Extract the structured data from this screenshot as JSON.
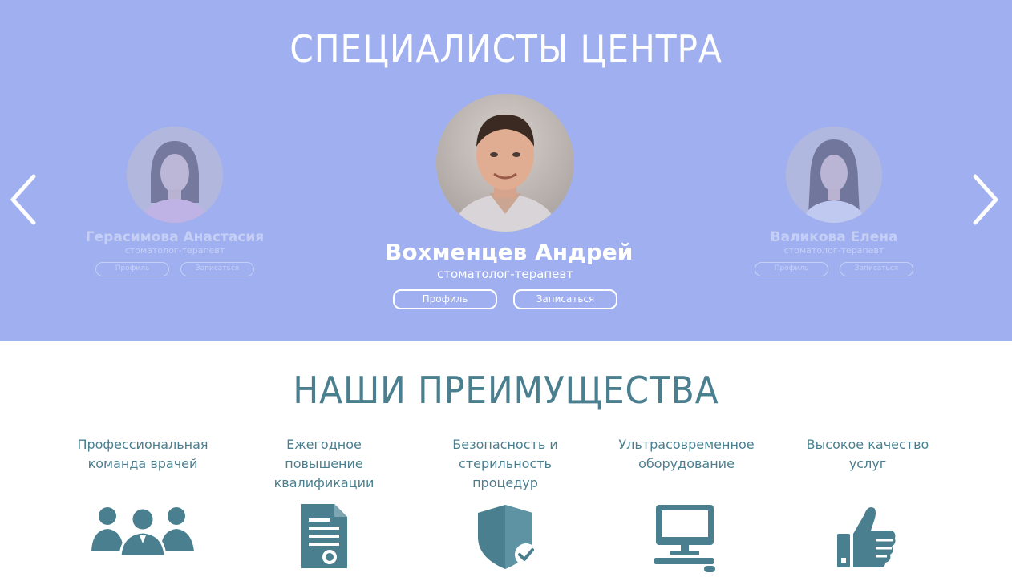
{
  "specialists": {
    "title": "СПЕЦИАЛИСТЫ ЦЕНТРА",
    "doctors": [
      {
        "name": "Герасимова Анастасия",
        "role": "стоматолог-терапевт",
        "profile_label": "Профиль",
        "book_label": "Записаться"
      },
      {
        "name": "Вохменцев Андрей",
        "role": "стоматолог-терапевт",
        "profile_label": "Профиль",
        "book_label": "Записаться"
      },
      {
        "name": "Валикова Елена",
        "role": "стоматолог-терапевт",
        "profile_label": "Профиль",
        "book_label": "Записаться"
      }
    ],
    "prev_icon": "chevron-left-icon",
    "next_icon": "chevron-right-icon"
  },
  "advantages": {
    "title": "НАШИ ПРЕИМУЩЕСТВА",
    "items": [
      {
        "label": "Профессиональная команда врачей",
        "icon": "team-icon"
      },
      {
        "label": "Ежегодное повышение квалификации",
        "icon": "certificate-icon"
      },
      {
        "label": "Безопасность и стерильность процедур",
        "icon": "shield-check-icon"
      },
      {
        "label": "Ультрасовременное оборудование",
        "icon": "computer-icon"
      },
      {
        "label": "Высокое качество услуг",
        "icon": "thumbs-up-icon"
      }
    ]
  },
  "colors": {
    "specialists_bg": "#9faff0",
    "accent": "#4a7f8f",
    "text_light": "#ffffff"
  }
}
